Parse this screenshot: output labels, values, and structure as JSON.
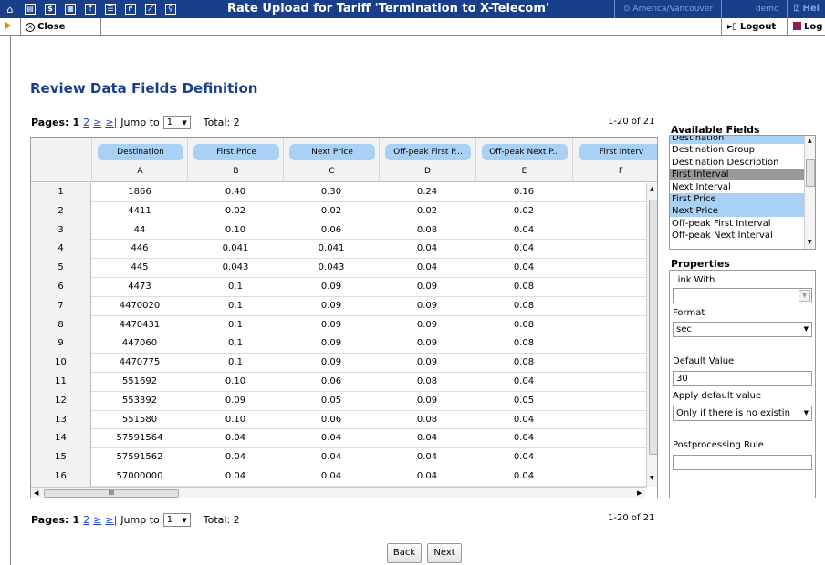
{
  "header": {
    "title": "Rate Upload for Tariff 'Termination to X-Telecom'",
    "timezone": "America/Vancouver",
    "user": "demo",
    "help": "Hel",
    "icons": [
      "home-icon",
      "grid-icon",
      "dollar-icon",
      "apps-icon",
      "tariff-icon",
      "list-icon",
      "export-icon",
      "chart-icon",
      "search-icon"
    ]
  },
  "toolbar": {
    "close_label": "Close",
    "logout_label": "Logout",
    "log_label": "Log"
  },
  "page": {
    "heading": "Review Data Fields Definition"
  },
  "pager_top": {
    "label": "Pages:",
    "current": "1",
    "next_page": "2",
    "next_sym": "≥",
    "last_sym": "≥|",
    "jump_label": "Jump to",
    "jump_value": "1",
    "total": "Total: 2",
    "range": "1-20 of 21"
  },
  "pager_bottom": {
    "label": "Pages:",
    "current": "1",
    "next_page": "2",
    "next_sym": "≥",
    "last_sym": "≥|",
    "jump_label": "Jump to",
    "jump_value": "1",
    "total": "Total: 2",
    "range": "1-20 of 21"
  },
  "grid": {
    "columns": [
      {
        "name": "Destination",
        "letter": "A"
      },
      {
        "name": "First Price",
        "letter": "B"
      },
      {
        "name": "Next Price",
        "letter": "C"
      },
      {
        "name": "Off-peak First P...",
        "letter": "D"
      },
      {
        "name": "Off-peak Next P...",
        "letter": "E"
      },
      {
        "name": "First Interv",
        "letter": "F"
      }
    ],
    "rows": [
      [
        "1",
        "1866",
        "0.40",
        "0.30",
        "0.24",
        "0.16"
      ],
      [
        "2",
        "4411",
        "0.02",
        "0.02",
        "0.02",
        "0.02"
      ],
      [
        "3",
        "44",
        "0.10",
        "0.06",
        "0.08",
        "0.04"
      ],
      [
        "4",
        "446",
        "0.041",
        "0.041",
        "0.04",
        "0.04"
      ],
      [
        "5",
        "445",
        "0.043",
        "0.043",
        "0.04",
        "0.04"
      ],
      [
        "6",
        "4473",
        "0.1",
        "0.09",
        "0.09",
        "0.08"
      ],
      [
        "7",
        "4470020",
        "0.1",
        "0.09",
        "0.09",
        "0.08"
      ],
      [
        "8",
        "4470431",
        "0.1",
        "0.09",
        "0.09",
        "0.08"
      ],
      [
        "9",
        "447060",
        "0.1",
        "0.09",
        "0.09",
        "0.08"
      ],
      [
        "10",
        "4470775",
        "0.1",
        "0.09",
        "0.09",
        "0.08"
      ],
      [
        "11",
        "551692",
        "0.10",
        "0.06",
        "0.08",
        "0.04"
      ],
      [
        "12",
        "553392",
        "0.09",
        "0.05",
        "0.09",
        "0.05"
      ],
      [
        "13",
        "551580",
        "0.10",
        "0.06",
        "0.08",
        "0.04"
      ],
      [
        "14",
        "57591564",
        "0.04",
        "0.04",
        "0.04",
        "0.04"
      ],
      [
        "15",
        "57591562",
        "0.04",
        "0.04",
        "0.04",
        "0.04"
      ],
      [
        "16",
        "57000000",
        "0.04",
        "0.04",
        "0.04",
        "0.04"
      ]
    ],
    "hscroll_label": "III"
  },
  "available_fields": {
    "title": "Available Fields",
    "items": [
      {
        "label": "Destination",
        "state": "highlighted"
      },
      {
        "label": "Destination Group",
        "state": "normal"
      },
      {
        "label": "Destination Description",
        "state": "normal"
      },
      {
        "label": "First Interval",
        "state": "selected"
      },
      {
        "label": "Next Interval",
        "state": "normal"
      },
      {
        "label": "First Price",
        "state": "highlighted"
      },
      {
        "label": "Next Price",
        "state": "highlighted"
      },
      {
        "label": "Off-peak First Interval",
        "state": "normal"
      },
      {
        "label": "Off-peak Next Interval",
        "state": "normal"
      }
    ]
  },
  "properties": {
    "title": "Properties",
    "link_with_label": "Link With",
    "link_with_value": "",
    "format_label": "Format",
    "format_value": "sec",
    "default_value_label": "Default Value",
    "default_value": "30",
    "apply_default_label": "Apply default value",
    "apply_default_value": "Only if there is no existin",
    "postprocessing_label": "Postprocessing Rule",
    "postprocessing_value": ""
  },
  "buttons": {
    "back": "Back",
    "next": "Next"
  }
}
